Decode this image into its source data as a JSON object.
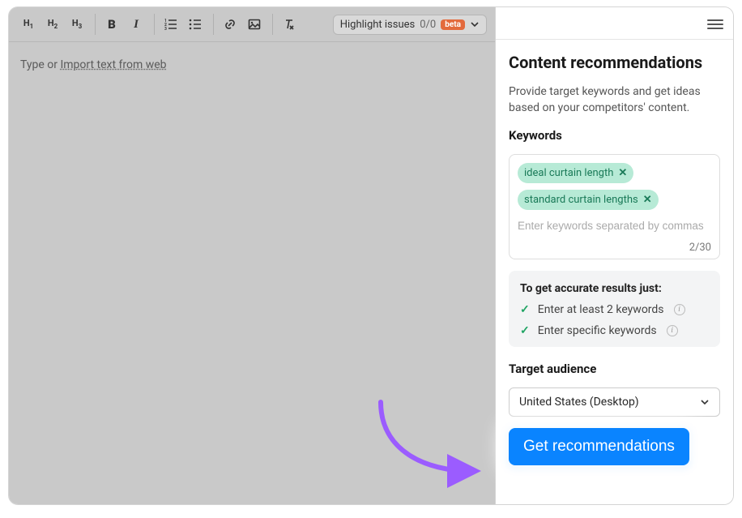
{
  "toolbar": {
    "h1": "H",
    "h1n": "1",
    "h2": "H",
    "h2n": "2",
    "h3": "H",
    "h3n": "3",
    "highlight_label": "Highlight issues",
    "highlight_count": "0/0",
    "beta": "beta"
  },
  "editor": {
    "placeholder_prefix": "Type or ",
    "import_link": "Import text from web"
  },
  "sidebar": {
    "title": "Content recommendations",
    "desc": "Provide target keywords and get ideas based on your competitors' content.",
    "keywords_label": "Keywords",
    "keywords": [
      "ideal curtain length",
      "standard curtain lengths"
    ],
    "kw_placeholder": "Enter keywords separated by commas",
    "kw_count": "2/30",
    "tips_title": "To get accurate results just:",
    "tip1": "Enter at least 2 keywords",
    "tip2": "Enter specific keywords",
    "audience_label": "Target audience",
    "audience_value": "United States (Desktop)",
    "cta": "Get recommendations"
  }
}
